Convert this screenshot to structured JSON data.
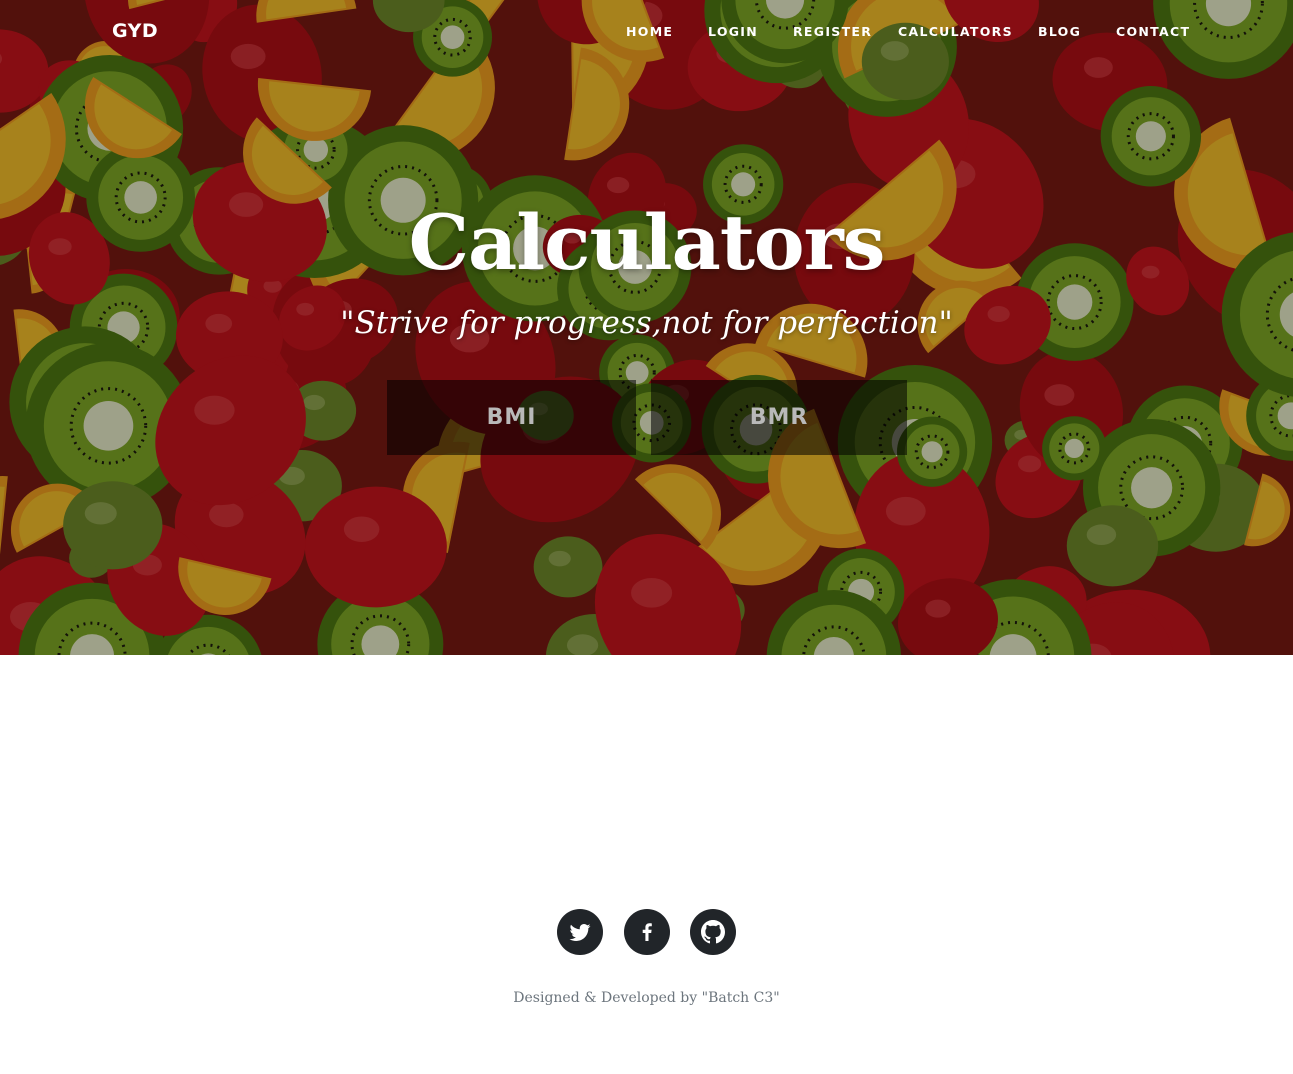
{
  "nav": {
    "brand": "GYD",
    "items": [
      {
        "label": "HOME"
      },
      {
        "label": "LOGIN"
      },
      {
        "label": "REGISTER"
      },
      {
        "label": "CALCULATORS"
      },
      {
        "label": "BLOG"
      },
      {
        "label": "CONTACT"
      }
    ]
  },
  "hero": {
    "title": "Calculators",
    "quote": "\"Strive for progress,not for perfection\"",
    "buttons": [
      {
        "label": "BMI"
      },
      {
        "label": "BMR"
      }
    ],
    "background": "fruit-salad-photo"
  },
  "footer": {
    "social": [
      {
        "icon": "twitter-icon"
      },
      {
        "icon": "facebook-icon"
      },
      {
        "icon": "github-icon"
      }
    ],
    "credit": "Designed & Developed by \"Batch C3\""
  },
  "colors": {
    "overlay": "#000000",
    "button_text": "#b9b9b9",
    "social_bg": "#212529",
    "credit_text": "#6c757d"
  }
}
